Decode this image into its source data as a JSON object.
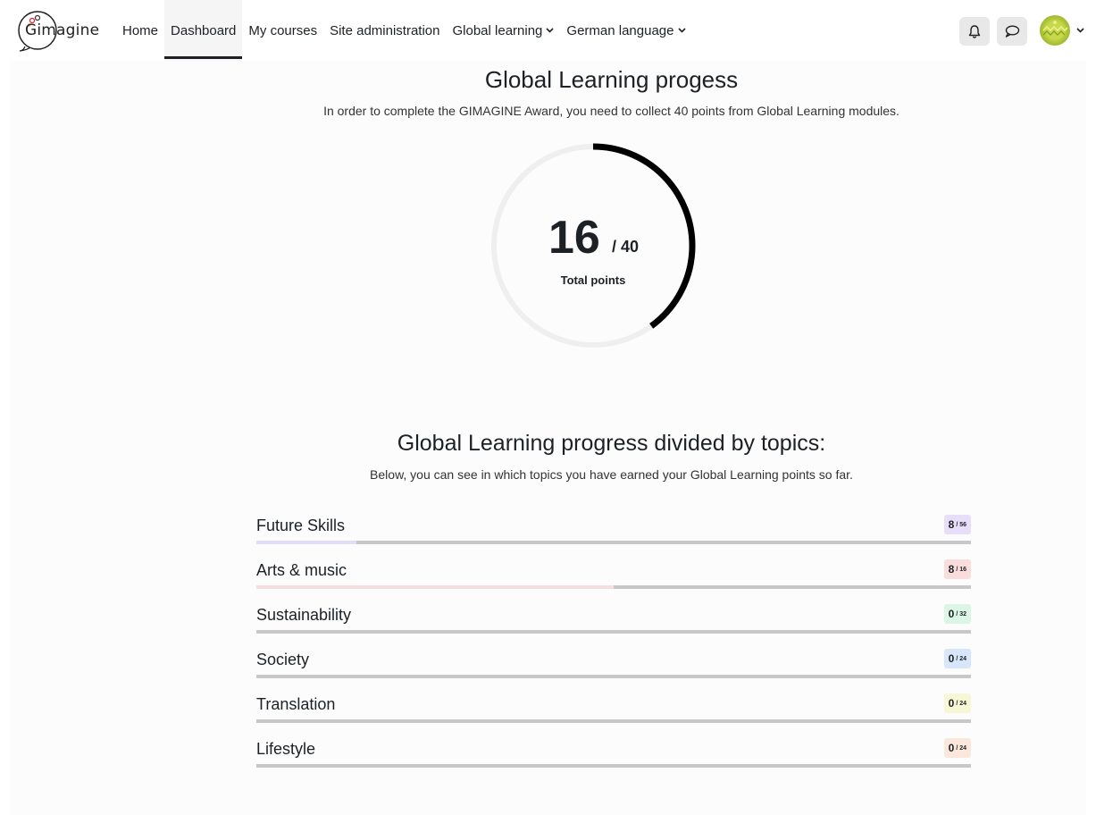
{
  "nav": {
    "logo_text": "Gimagine",
    "items": [
      {
        "label": "Home",
        "active": false,
        "dropdown": false
      },
      {
        "label": "Dashboard",
        "active": true,
        "dropdown": false
      },
      {
        "label": "My courses",
        "active": false,
        "dropdown": false
      },
      {
        "label": "Site administration",
        "active": false,
        "dropdown": false
      },
      {
        "label": "Global learning",
        "active": false,
        "dropdown": true
      },
      {
        "label": "German language",
        "active": false,
        "dropdown": true
      }
    ],
    "icons": [
      "bell-icon",
      "chat-bubble-icon",
      "chevron-down-icon"
    ]
  },
  "progress": {
    "title": "Global Learning progess",
    "subtitle": "In order to complete the GIMAGINE Award, you need to collect 40 points from Global Learning modules.",
    "points": "16",
    "total": "/ 40",
    "points_value": 16,
    "total_value": 40,
    "label": "Total points"
  },
  "topics_section": {
    "title": "Global Learning progress divided by topics:",
    "subtitle": "Below, you can see in which topics you have earned your Global Learning points so far.",
    "topics": [
      {
        "name": "Future Skills",
        "points": "8",
        "max": "/ 56",
        "fraction": 0.14,
        "fill": "#e3dcfb",
        "badge": "#e7def9"
      },
      {
        "name": "Arts & music",
        "points": "8",
        "max": "/ 16",
        "fraction": 0.5,
        "fill": "#f8dede",
        "badge": "#f9dcdc"
      },
      {
        "name": "Sustainability",
        "points": "0",
        "max": "/ 32",
        "fraction": 0,
        "fill": "#d9f5e2",
        "badge": "#dcf6e5"
      },
      {
        "name": "Society",
        "points": "0",
        "max": "/ 24",
        "fraction": 0,
        "fill": "#d8e6fb",
        "badge": "#d8e6fb"
      },
      {
        "name": "Translation",
        "points": "0",
        "max": "/ 24",
        "fraction": 0,
        "fill": "#f6f7d6",
        "badge": "#f6f8d5"
      },
      {
        "name": "Lifestyle",
        "points": "0",
        "max": "/ 24",
        "fraction": 0,
        "fill": "#fbe6da",
        "badge": "#fbe7dc"
      }
    ]
  },
  "colors": {
    "ring_track": "#efefef",
    "ring_fill": "#000000",
    "bar_track": "#c8c8c8"
  }
}
